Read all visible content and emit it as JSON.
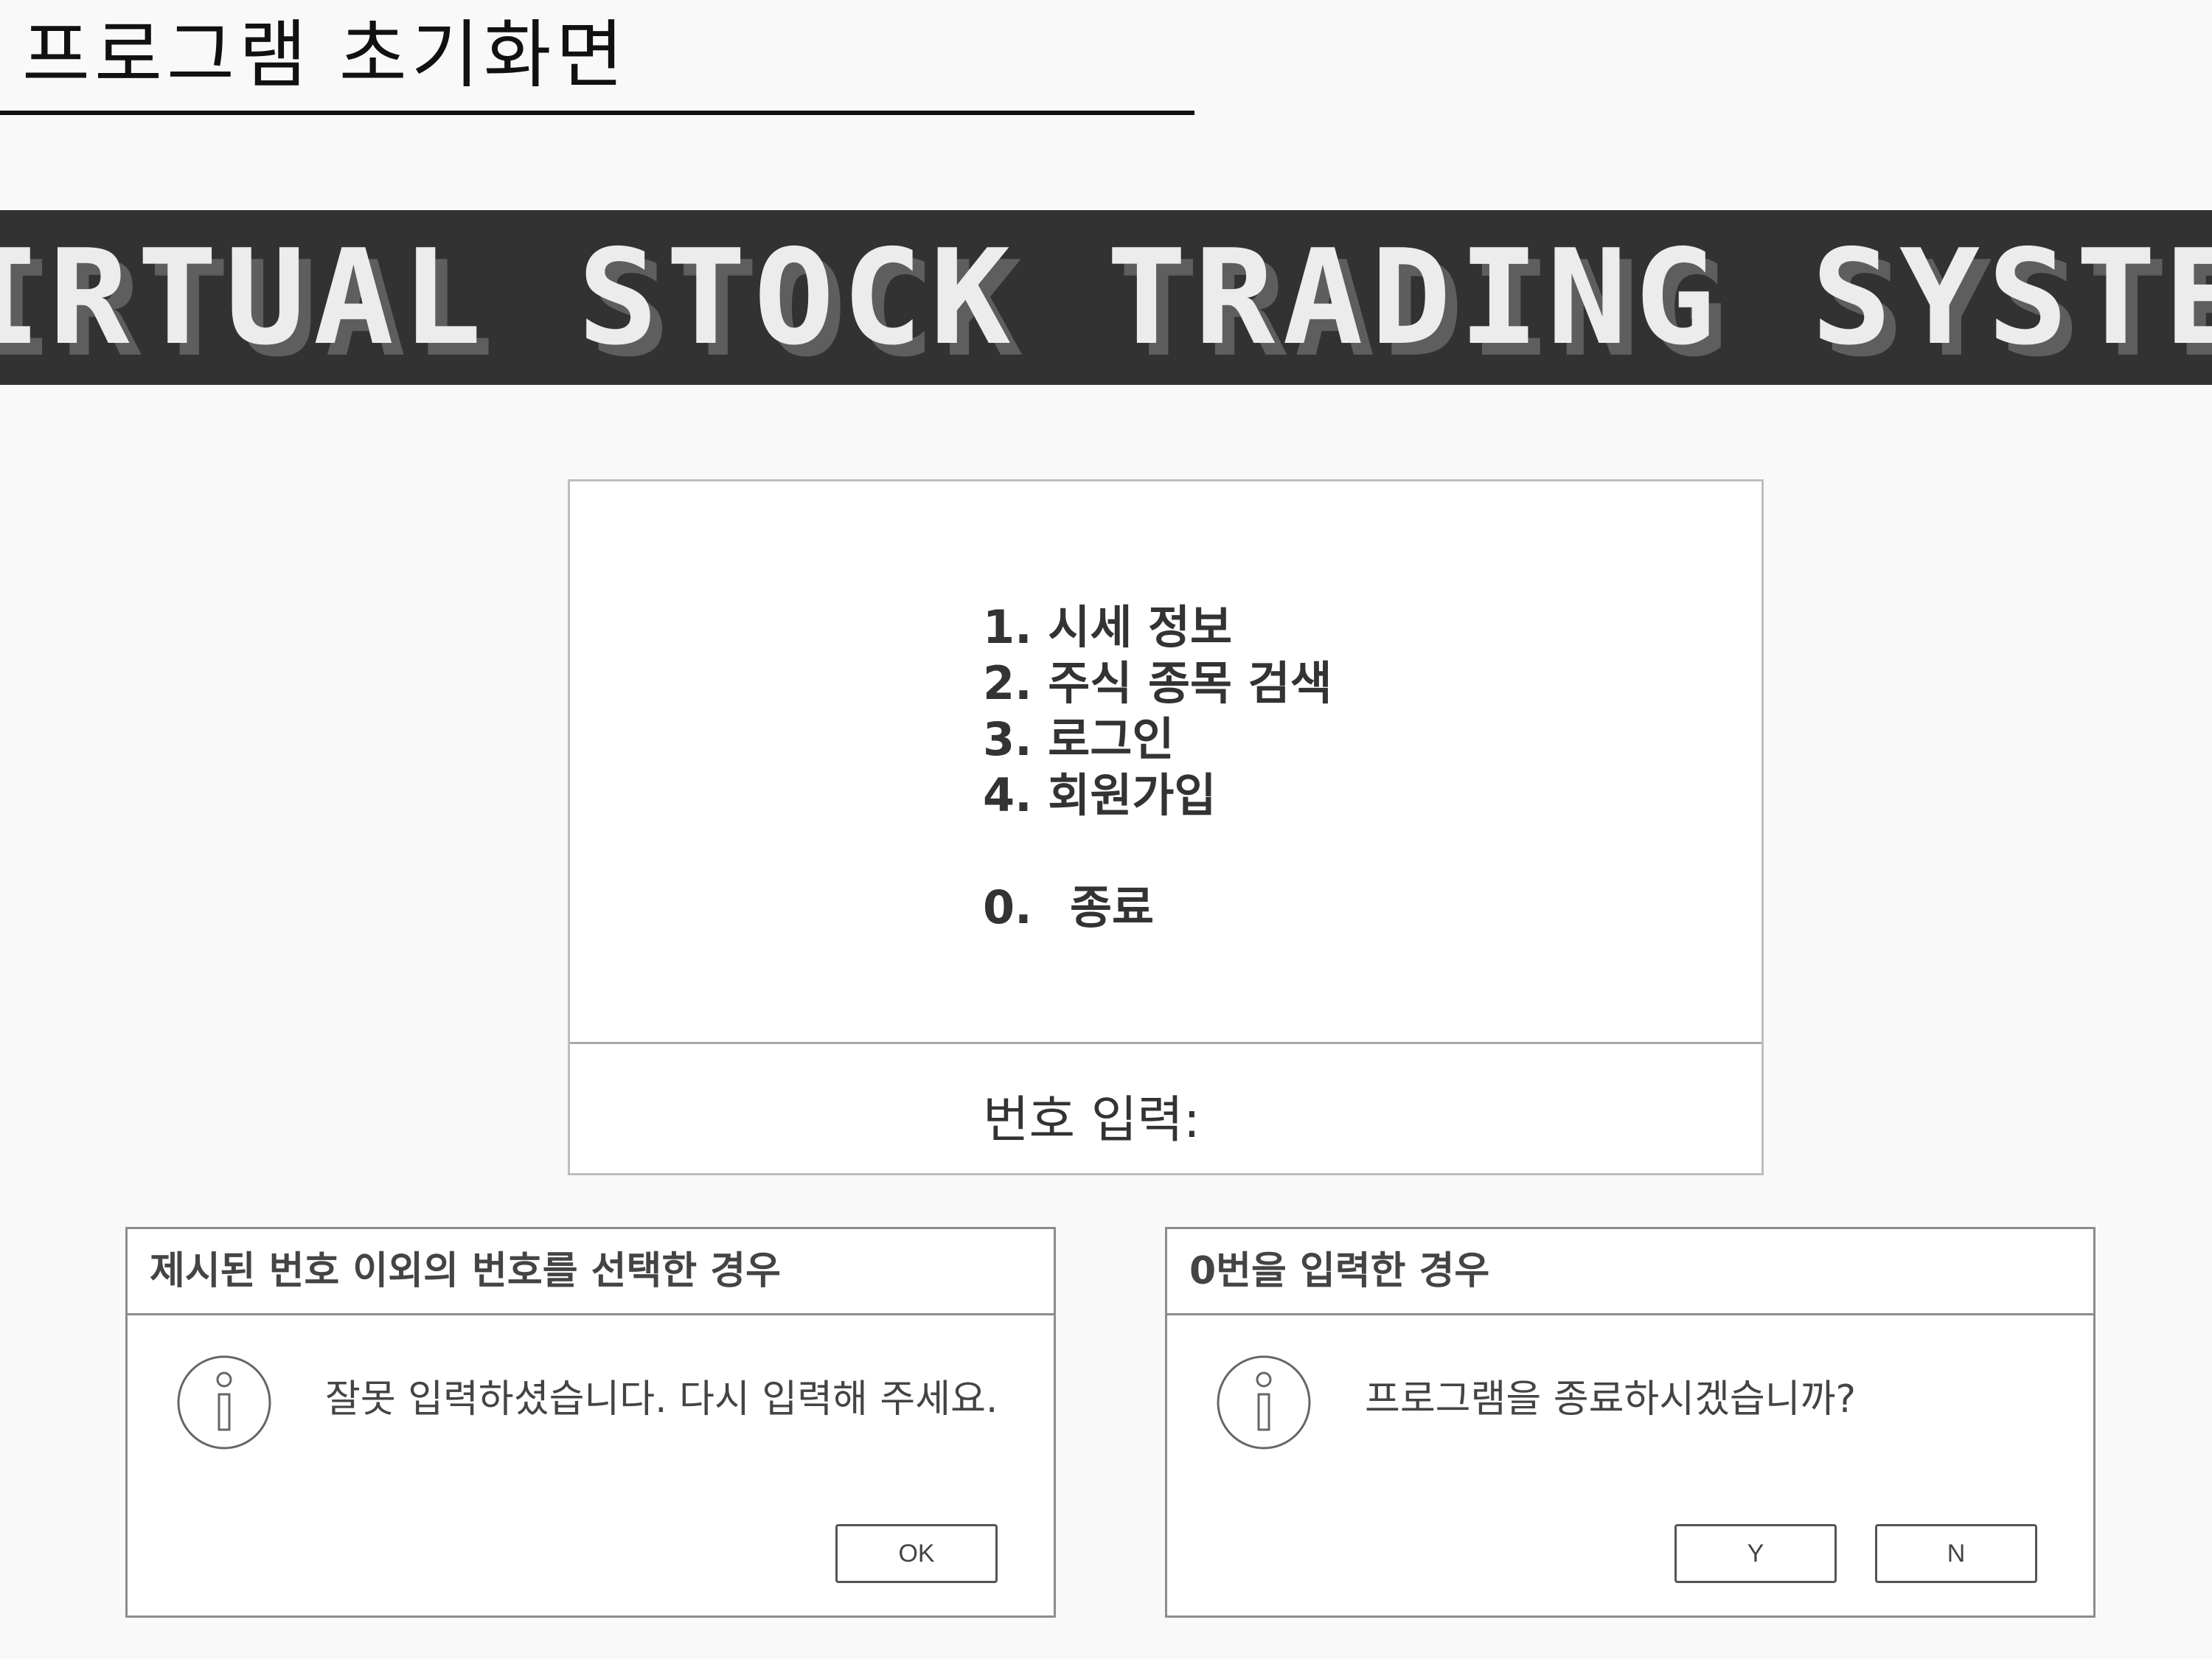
{
  "page": {
    "title": "프로그램  초기화면"
  },
  "banner": {
    "text": "VIRTUAL STOCK TRADING SYSTEM"
  },
  "menu": {
    "items": [
      "1. 시세 정보",
      "2. 주식 종목 검색",
      "3. 로그인",
      "4. 회원가입"
    ],
    "exit": {
      "number": "0.",
      "label": "종료"
    },
    "input_label": "번호 입력:"
  },
  "dialogs": {
    "invalid": {
      "title": "제시된 번호 이외의 번호를 선택한 경우",
      "message": "잘못 입력하셨습니다. 다시 입력해 주세요.",
      "ok_label": "OK",
      "icon": "info-icon"
    },
    "exit_confirm": {
      "title": "0번을 입력한 경우",
      "message": "프로그램을 종료하시겠습니까?",
      "yes_label": "Y",
      "no_label": "N",
      "icon": "info-icon"
    }
  },
  "colors": {
    "banner_bg": "#323232",
    "banner_text": "#ececec",
    "page_bg": "#f9f9f9"
  }
}
